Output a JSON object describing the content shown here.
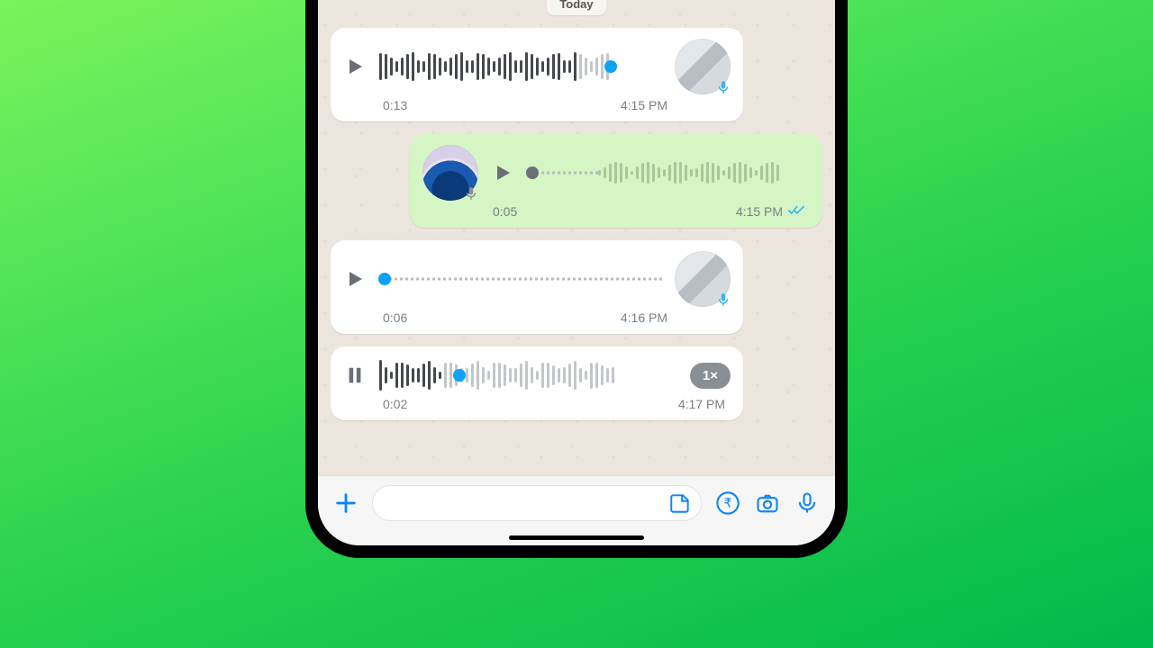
{
  "date_label": "Today",
  "messages": [
    {
      "kind": "incoming",
      "state": "paused",
      "wave_style": "bars",
      "progress": 0.82,
      "duration": "0:13",
      "time": "4:15 PM",
      "avatar": "keyboard",
      "mic_color": "#34b7f1"
    },
    {
      "kind": "outgoing",
      "state": "paused",
      "wave_style": "bars-faint-with-dot",
      "progress": 0.03,
      "duration": "0:05",
      "time": "4:15 PM",
      "read_ticks": true,
      "avatar": "wave",
      "mic_color": "#8a8f96"
    },
    {
      "kind": "incoming",
      "state": "paused",
      "wave_style": "dots",
      "progress": 0.02,
      "duration": "0:06",
      "time": "4:16 PM",
      "avatar": "keyboard",
      "mic_color": "#34b7f1"
    },
    {
      "kind": "incoming-last",
      "state": "playing",
      "wave_style": "bars",
      "progress": 0.27,
      "duration": "0:02",
      "time": "4:17 PM",
      "speed": "1×"
    }
  ],
  "input": {
    "placeholder": ""
  }
}
